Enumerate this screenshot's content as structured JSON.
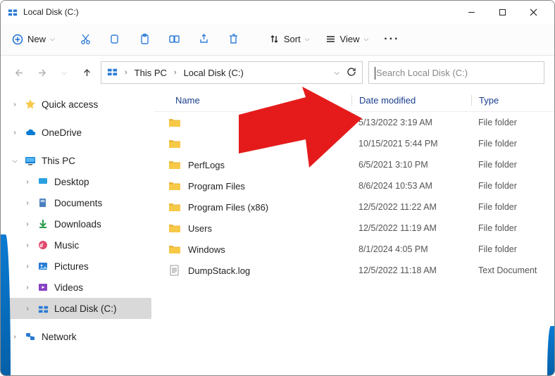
{
  "title": "Local Disk (C:)",
  "toolbar": {
    "new_label": "New",
    "sort_label": "Sort",
    "view_label": "View"
  },
  "breadcrumb": {
    "seg1": "This PC",
    "seg2": "Local Disk (C:)"
  },
  "search": {
    "placeholder": "Search Local Disk (C:)"
  },
  "sidebar": {
    "quick_access": "Quick access",
    "onedrive": "OneDrive",
    "this_pc": "This PC",
    "desktop": "Desktop",
    "documents": "Documents",
    "downloads": "Downloads",
    "music": "Music",
    "pictures": "Pictures",
    "videos": "Videos",
    "local_disk": "Local Disk (C:)",
    "network": "Network"
  },
  "headers": {
    "name": "Name",
    "date": "Date modified",
    "type": "Type"
  },
  "rows": [
    {
      "name": "",
      "date": "5/13/2022 3:19 AM",
      "type": "File folder",
      "icon": "folder"
    },
    {
      "name": "",
      "date": "10/15/2021 5:44 PM",
      "type": "File folder",
      "icon": "folder"
    },
    {
      "name": "PerfLogs",
      "date": "6/5/2021 3:10 PM",
      "type": "File folder",
      "icon": "folder"
    },
    {
      "name": "Program Files",
      "date": "8/6/2024 10:53 AM",
      "type": "File folder",
      "icon": "folder"
    },
    {
      "name": "Program Files (x86)",
      "date": "12/5/2022 11:22 AM",
      "type": "File folder",
      "icon": "folder"
    },
    {
      "name": "Users",
      "date": "12/5/2022 11:19 AM",
      "type": "File folder",
      "icon": "folder"
    },
    {
      "name": "Windows",
      "date": "8/1/2024 4:05 PM",
      "type": "File folder",
      "icon": "folder"
    },
    {
      "name": "DumpStack.log",
      "date": "12/5/2022 11:18 AM",
      "type": "Text Document",
      "icon": "file"
    }
  ]
}
